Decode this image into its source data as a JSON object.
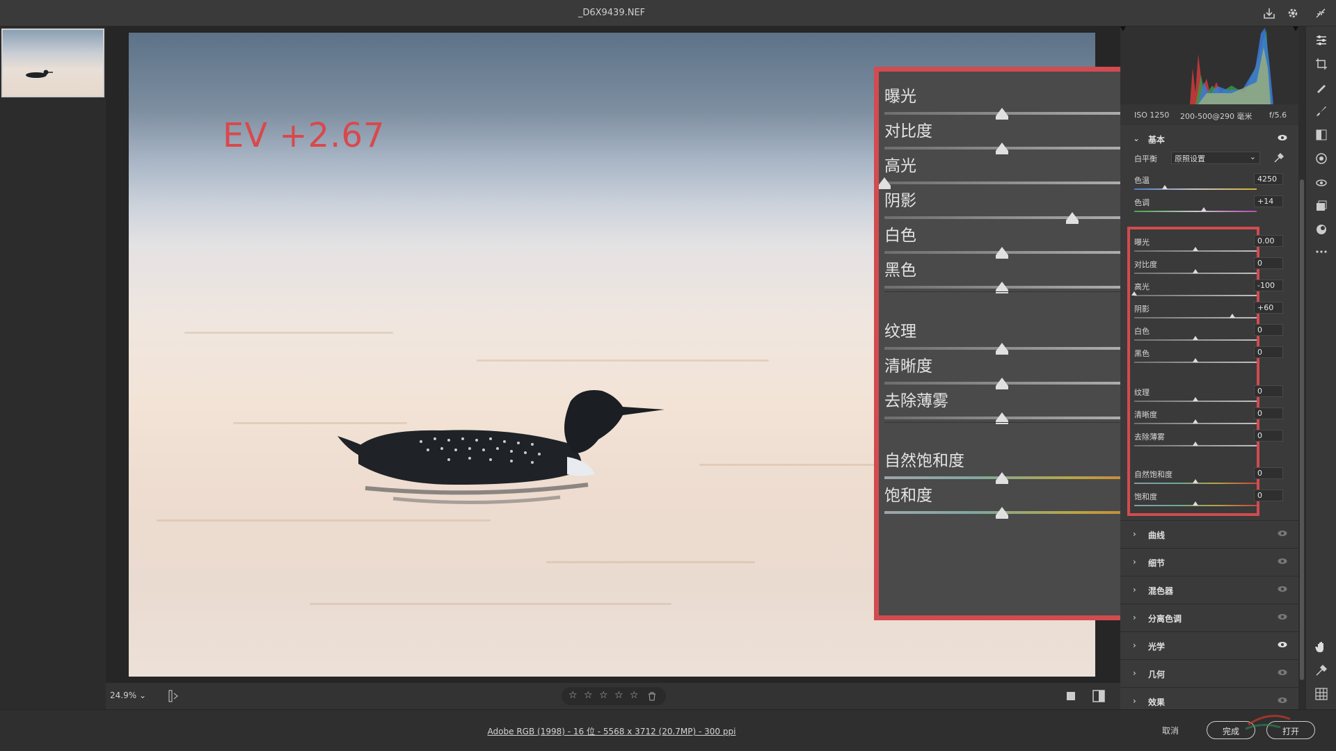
{
  "window": {
    "title": "_D6X9439.NEF"
  },
  "photo": {
    "ev_label": "EV +2.67"
  },
  "zoom_panel": {
    "rows": [
      {
        "label": "曝光",
        "value": "0.00",
        "position": 0.5
      },
      {
        "label": "对比度",
        "value": "0",
        "position": 0.5
      },
      {
        "label": "高光",
        "value": "-100",
        "position": 0.0
      },
      {
        "label": "阴影",
        "value": "+60",
        "position": 0.8
      },
      {
        "label": "白色",
        "value": "0",
        "position": 0.5
      },
      {
        "label": "黑色",
        "value": "0",
        "position": 0.5
      },
      {
        "label": "纹理",
        "value": "0",
        "position": 0.5
      },
      {
        "label": "清晰度",
        "value": "0",
        "position": 0.5
      },
      {
        "label": "去除薄雾",
        "value": "0",
        "position": 0.5
      },
      {
        "label": "自然饱和度",
        "value": "0",
        "position": 0.5
      },
      {
        "label": "饱和度",
        "value": "0",
        "position": 0.5
      }
    ]
  },
  "canvas_bottom": {
    "zoom": "24.9%"
  },
  "status": {
    "file_info": "Adobe RGB (1998) - 16 位 - 5568 x 3712 (20.7MP) - 300 ppi",
    "cancel": "取消",
    "done": "完成",
    "open": "打开"
  },
  "right_panel": {
    "camera": {
      "iso": "ISO 1250",
      "lens": "200-500@290 毫米",
      "aperture": "f/5.6"
    },
    "basic": {
      "title": "基本",
      "white_balance_label": "白平衡",
      "white_balance_value": "原照设置",
      "temp": {
        "label": "色温",
        "value": "4250",
        "position": 0.25
      },
      "tint": {
        "label": "色调",
        "value": "+14",
        "position": 0.57
      },
      "tone": [
        {
          "label": "曝光",
          "value": "0.00",
          "position": 0.5
        },
        {
          "label": "对比度",
          "value": "0",
          "position": 0.5
        },
        {
          "label": "高光",
          "value": "-100",
          "position": 0.0
        },
        {
          "label": "阴影",
          "value": "+60",
          "position": 0.8
        },
        {
          "label": "白色",
          "value": "0",
          "position": 0.5
        },
        {
          "label": "黑色",
          "value": "0",
          "position": 0.5
        }
      ],
      "presence": [
        {
          "label": "纹理",
          "value": "0",
          "position": 0.5
        },
        {
          "label": "清晰度",
          "value": "0",
          "position": 0.5
        },
        {
          "label": "去除薄雾",
          "value": "0",
          "position": 0.5
        }
      ],
      "color": [
        {
          "label": "自然饱和度",
          "value": "0",
          "position": 0.5
        },
        {
          "label": "饱和度",
          "value": "0",
          "position": 0.5
        }
      ]
    },
    "sections": [
      "曲线",
      "细节",
      "混色器",
      "分离色调",
      "光学",
      "几何",
      "效果"
    ]
  },
  "colors": {
    "accent_red": "#d14b50"
  }
}
